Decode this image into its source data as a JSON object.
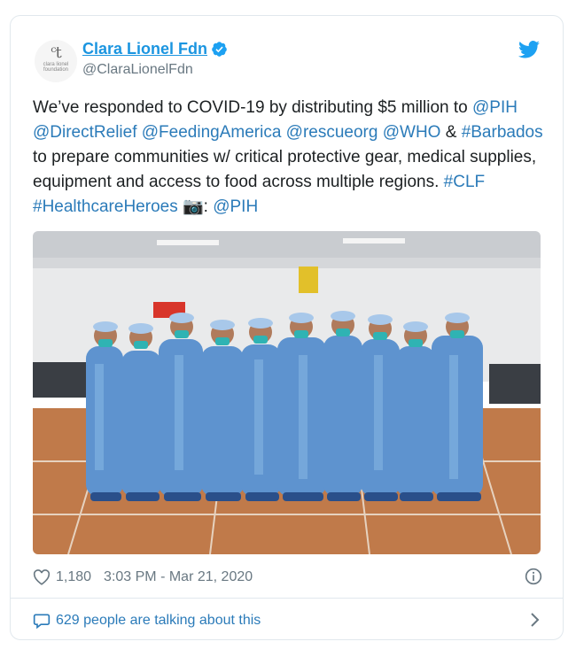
{
  "tweet": {
    "author_name": "Clara Lionel Fdn",
    "handle": "@ClaraLionelFdn",
    "avatar_monogram": "ᶜt",
    "avatar_text_line1": "clara lionel",
    "avatar_text_line2": "foundation",
    "text_segments": [
      {
        "text": "We’ve responded to COVID-19 by distributing $5 million to ",
        "link": false
      },
      {
        "text": "@PIH @DirectRelief @FeedingAmerica @rescueorg @WHO",
        "link": true
      },
      {
        "text": " & ",
        "link": false
      },
      {
        "text": "#Barbados",
        "link": true
      },
      {
        "text": " to prepare communities w/ critical protective gear, medical supplies, equipment and access to food across multiple regions.  ",
        "link": false
      },
      {
        "text": "#CLF #HealthcareHeroes",
        "link": true
      },
      {
        "text": " 📷: ",
        "link": false
      },
      {
        "text": "@PIH",
        "link": true
      }
    ],
    "likes": "1,180",
    "timestamp": "3:03 PM - Mar 21, 2020",
    "talking_text": "629 people are talking about this"
  },
  "colors": {
    "link": "#2b7bb9",
    "meta_gray": "#697882",
    "twitter_blue": "#1da1f2",
    "border": "#e1e8ed"
  },
  "icons": {
    "verified": "verified-badge-icon",
    "bird": "twitter-bird-icon",
    "heart": "heart-icon",
    "info": "info-icon",
    "bubble": "speech-bubble-icon",
    "chevron": "chevron-right-icon",
    "camera": "camera-emoji"
  }
}
